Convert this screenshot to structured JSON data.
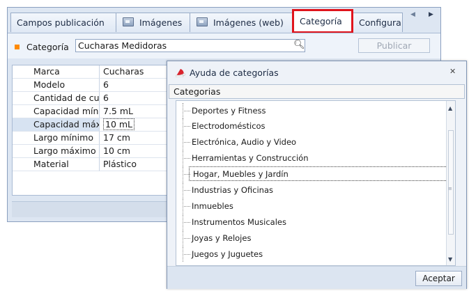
{
  "tabs": {
    "items": [
      {
        "label": "Campos publicación",
        "icon": ""
      },
      {
        "label": "Imágenes",
        "icon": "image-icon"
      },
      {
        "label": "Imágenes (web)",
        "icon": "image-icon"
      },
      {
        "label": "Categoría",
        "icon": "",
        "active": true
      },
      {
        "label": "Configura",
        "icon": ""
      }
    ]
  },
  "category_row": {
    "label": "Categoría",
    "value": "Cucharas Medidoras",
    "publish_label": "Publicar",
    "lookup_icon": "search-help-icon",
    "marker_color": "#ff8a00"
  },
  "grid": {
    "rows": [
      {
        "key": "Marca",
        "value": "Cucharas"
      },
      {
        "key": "Modelo",
        "value": "6"
      },
      {
        "key": "Cantidad de cuc",
        "value": "6"
      },
      {
        "key": "Capacidad míni",
        "value": "7.5 mL"
      },
      {
        "key": "Capacidad máxi",
        "value": "10 mL",
        "selected": true
      },
      {
        "key": "Largo mínimo",
        "value": "17 cm"
      },
      {
        "key": "Largo máximo",
        "value": "10 cm"
      },
      {
        "key": "Material",
        "value": "Plástico"
      }
    ]
  },
  "dialog": {
    "title": "Ayuda de categorías",
    "header": "Categorias",
    "items": [
      "Deportes y Fitness",
      "Electrodomésticos",
      "Electrónica, Audio y Video",
      "Herramientas y Construcción",
      "Hogar, Muebles y Jardín",
      "Industrias y Oficinas",
      "Inmuebles",
      "Instrumentos Musicales",
      "Joyas y Relojes",
      "Juegos y Juguetes"
    ],
    "selected_index": 4,
    "ok_label": "Aceptar",
    "close_icon": "close-icon"
  },
  "colors": {
    "active_tab_border": "#e0141c"
  }
}
